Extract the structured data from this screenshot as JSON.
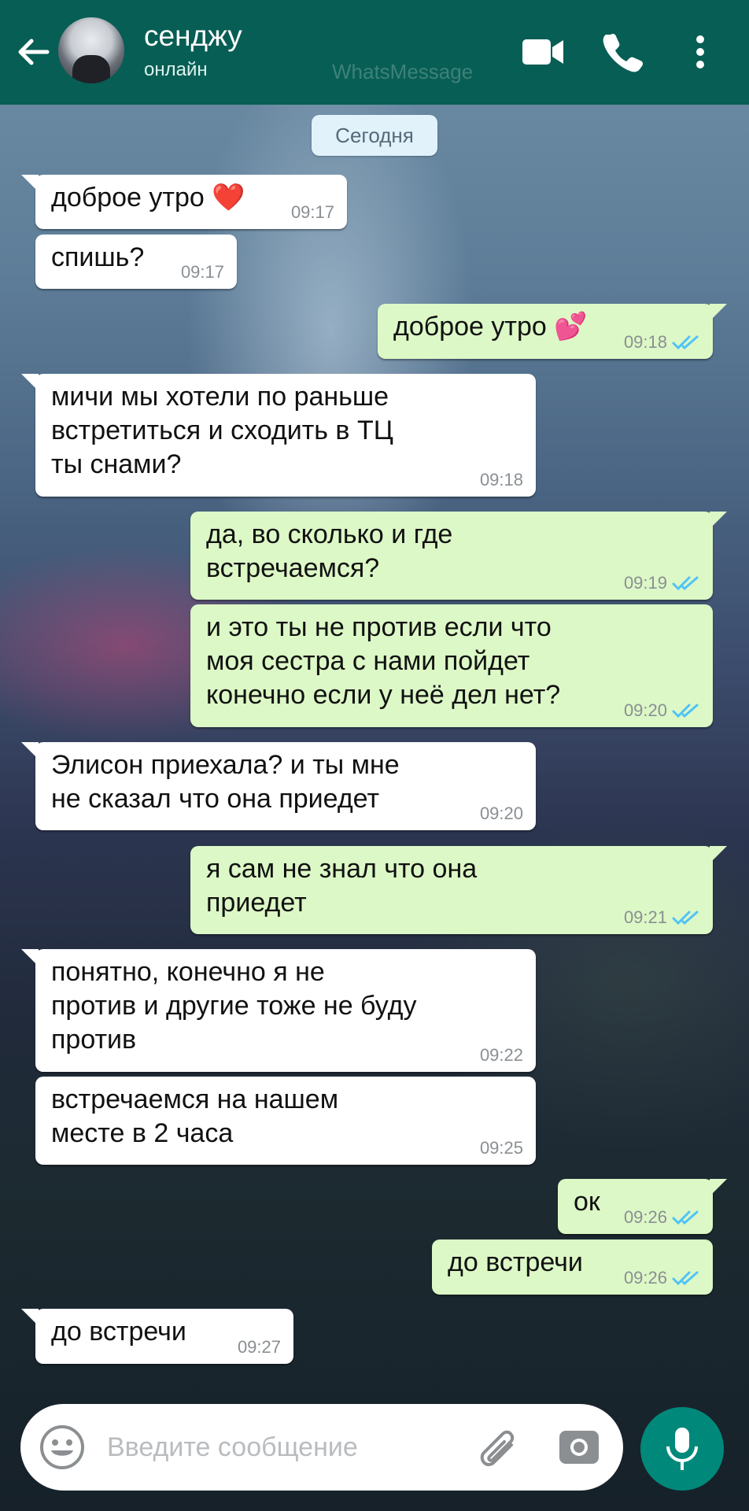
{
  "header": {
    "contact_name": "сенджу",
    "status": "онлайн",
    "watermark": "WhatsMessage",
    "icons": [
      "back-arrow-icon",
      "video-call-icon",
      "phone-call-icon",
      "more-vert-icon"
    ],
    "bg_color": "#075e54"
  },
  "chat": {
    "date_label": "Сегодня",
    "messages": [
      {
        "dir": "in",
        "text": "доброе утро ❤️",
        "time": "09:17"
      },
      {
        "dir": "in",
        "text": "спишь?",
        "time": "09:17"
      },
      {
        "dir": "out",
        "text": "доброе утро 💕",
        "time": "09:18",
        "read": true
      },
      {
        "dir": "in",
        "text": "мичи мы хотели по раньше\nвстретиться и сходить в ТЦ\nты снами?",
        "time": "09:18"
      },
      {
        "dir": "out",
        "text": "да, во сколько и где\nвстречаемся?",
        "time": "09:19",
        "read": true
      },
      {
        "dir": "out",
        "text": "и это ты не против если что\nмоя сестра с нами пойдет\nконечно если у неё дел нет?",
        "time": "09:20",
        "read": true
      },
      {
        "dir": "in",
        "text": "Элисон приехала?  и ты мне\nне сказал что она приедет",
        "time": "09:20"
      },
      {
        "dir": "out",
        "text": "я сам не знал что она\nприедет",
        "time": "09:21",
        "read": true
      },
      {
        "dir": "in",
        "text": "понятно, конечно я не\nпротив и другие тоже не буду\nпротив",
        "time": "09:22"
      },
      {
        "dir": "in",
        "text": "встречаемся на нашем\nместе в 2 часа",
        "time": "09:25"
      },
      {
        "dir": "out",
        "text": "ок",
        "time": "09:26",
        "read": true
      },
      {
        "dir": "out",
        "text": "до встречи",
        "time": "09:26",
        "read": true
      },
      {
        "dir": "in",
        "text": "до встречи",
        "time": "09:27"
      }
    ],
    "incoming_color": "#ffffff",
    "outgoing_color": "#dcf8c6",
    "read_tick_color": "#4fc3f7"
  },
  "composer": {
    "placeholder": "Введите сообщение",
    "icons": [
      "emoji-icon",
      "attach-icon",
      "camera-icon",
      "mic-icon"
    ],
    "mic_button_color": "#00897b"
  }
}
